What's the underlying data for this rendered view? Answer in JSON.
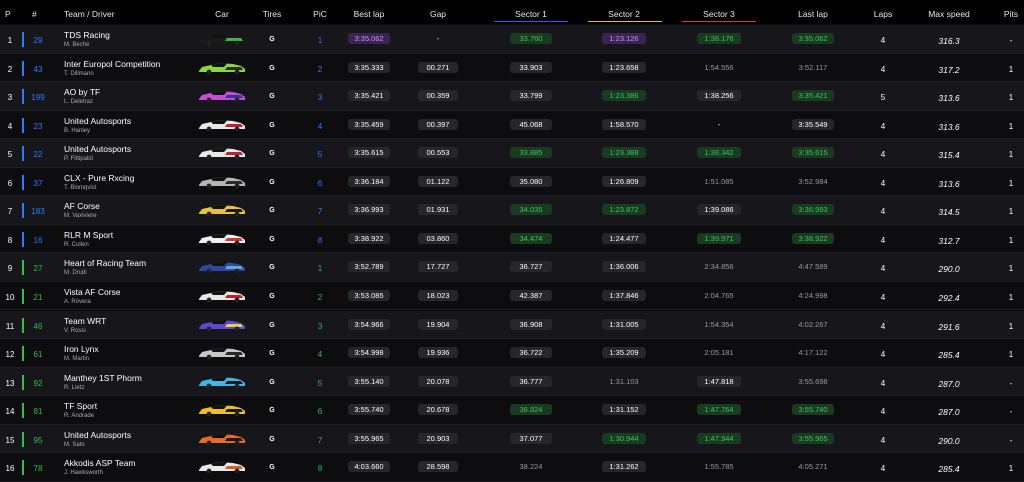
{
  "columns": {
    "p": "P",
    "num": "#",
    "team_driver": "Team / Driver",
    "car": "Car",
    "tires": "Tires",
    "pic": "PiC",
    "best_lap": "Best lap",
    "gap": "Gap",
    "sector1": "Sector 1",
    "sector2": "Sector 2",
    "sector3": "Sector 3",
    "last_lap": "Last lap",
    "laps": "Laps",
    "max_speed": "Max speed",
    "pits": "Pits"
  },
  "colors": {
    "hypercar": "#2f7bff",
    "lmgt3": "#2fbf4a",
    "sector1": "#3d4fff",
    "sector2": "#e6b84a",
    "sector3": "#d83a5a",
    "personal_best": "#35c759",
    "overall_best": "#b05cff"
  },
  "rows": [
    {
      "pos": "1",
      "num": "29",
      "team": "TDS Racing",
      "driver": "M. Beche",
      "class": "hypercar",
      "car_colors": [
        "#1a1a1a",
        "#45b34b"
      ],
      "tire": "G",
      "pic": "1",
      "best": "3:35.062",
      "best_s": "p",
      "gap": "-",
      "s1": "33.760",
      "s1_s": "g",
      "s2": "1:23.126",
      "s2_s": "p",
      "s3": "1:38.176",
      "s3_s": "g",
      "last": "3:35.062",
      "last_s": "g",
      "laps": "4",
      "speed": "316.3",
      "pits": "-"
    },
    {
      "pos": "2",
      "num": "43",
      "team": "Inter Europol Competition",
      "driver": "T. Dillmann",
      "class": "hypercar",
      "car_colors": [
        "#8fd63c",
        "#2a2a2a"
      ],
      "tire": "G",
      "pic": "2",
      "best": "3:35.333",
      "best_s": "w",
      "gap": "00.271",
      "s1": "33.903",
      "s1_s": "w",
      "s2": "1:23.658",
      "s2_s": "w",
      "s3": "1:54.556",
      "s3_s": "n",
      "last": "3:52.117",
      "last_s": "n",
      "laps": "4",
      "speed": "317.2",
      "pits": "1"
    },
    {
      "pos": "3",
      "num": "199",
      "team": "AO by TF",
      "driver": "L. Deletraz",
      "class": "hypercar",
      "car_colors": [
        "#c84bd6",
        "#2a3a8c"
      ],
      "tire": "G",
      "pic": "3",
      "best": "3:35.421",
      "best_s": "w",
      "gap": "00.359",
      "s1": "33.799",
      "s1_s": "w",
      "s2": "1:23.386",
      "s2_s": "g",
      "s3": "1:38.256",
      "s3_s": "w",
      "last": "3:35.421",
      "last_s": "g",
      "laps": "5",
      "speed": "313.6",
      "pits": "1"
    },
    {
      "pos": "4",
      "num": "23",
      "team": "United Autosports",
      "driver": "B. Hanley",
      "class": "hypercar",
      "car_colors": [
        "#e8e8e8",
        "#c0202a"
      ],
      "tire": "G",
      "pic": "4",
      "best": "3:35.459",
      "best_s": "w",
      "gap": "00.397",
      "s1": "45.068",
      "s1_s": "w",
      "s2": "1:58.570",
      "s2_s": "w",
      "s3": "-",
      "s3_s": "d",
      "last": "3:35.549",
      "last_s": "w",
      "laps": "4",
      "speed": "313.6",
      "pits": "1"
    },
    {
      "pos": "5",
      "num": "22",
      "team": "United Autosports",
      "driver": "P. Fittipaldi",
      "class": "hypercar",
      "car_colors": [
        "#e8e8e8",
        "#c0202a"
      ],
      "tire": "G",
      "pic": "5",
      "best": "3:35.615",
      "best_s": "w",
      "gap": "00.553",
      "s1": "33.885",
      "s1_s": "g",
      "s2": "1:23.388",
      "s2_s": "g",
      "s3": "1:38.342",
      "s3_s": "g",
      "last": "3:35.615",
      "last_s": "g",
      "laps": "4",
      "speed": "315.4",
      "pits": "1"
    },
    {
      "pos": "6",
      "num": "37",
      "team": "CLX - Pure Rxcing",
      "driver": "T. Blomqvist",
      "class": "hypercar",
      "car_colors": [
        "#b5b5b5",
        "#2a2a2a"
      ],
      "tire": "G",
      "pic": "6",
      "best": "3:36.184",
      "best_s": "w",
      "gap": "01.122",
      "s1": "35.080",
      "s1_s": "w",
      "s2": "1:26.809",
      "s2_s": "w",
      "s3": "1:51.085",
      "s3_s": "n",
      "last": "3:52.984",
      "last_s": "n",
      "laps": "4",
      "speed": "313.6",
      "pits": "1"
    },
    {
      "pos": "7",
      "num": "183",
      "team": "AF Corse",
      "driver": "M. Vaxiviere",
      "class": "hypercar",
      "car_colors": [
        "#e8c23a",
        "#1a1a1a"
      ],
      "tire": "G",
      "pic": "7",
      "best": "3:36.993",
      "best_s": "w",
      "gap": "01.931",
      "s1": "34.035",
      "s1_s": "g",
      "s2": "1:23.872",
      "s2_s": "g",
      "s3": "1:39.086",
      "s3_s": "w",
      "last": "3:36.993",
      "last_s": "g",
      "laps": "4",
      "speed": "314.5",
      "pits": "1"
    },
    {
      "pos": "8",
      "num": "16",
      "team": "RLR M Sport",
      "driver": "R. Cullen",
      "class": "hypercar",
      "car_colors": [
        "#f0f0f0",
        "#d03a2a"
      ],
      "tire": "G",
      "pic": "8",
      "best": "3:38.922",
      "best_s": "w",
      "gap": "03.860",
      "s1": "34.474",
      "s1_s": "g",
      "s2": "1:24.477",
      "s2_s": "w",
      "s3": "1:39.971",
      "s3_s": "g",
      "last": "3:38.922",
      "last_s": "g",
      "laps": "4",
      "speed": "312.7",
      "pits": "1"
    },
    {
      "pos": "9",
      "num": "27",
      "team": "Heart of Racing Team",
      "driver": "M. Drudi",
      "class": "lmgt3",
      "car_colors": [
        "#2a4aa0",
        "#6aa8d8"
      ],
      "tire": "G",
      "pic": "1",
      "best": "3:52.789",
      "best_s": "w",
      "gap": "17.727",
      "s1": "36.727",
      "s1_s": "w",
      "s2": "1:36.006",
      "s2_s": "w",
      "s3": "2:34.856",
      "s3_s": "n",
      "last": "4:47.589",
      "last_s": "n",
      "laps": "4",
      "speed": "290.0",
      "pits": "1"
    },
    {
      "pos": "10",
      "num": "21",
      "team": "Vista AF Corse",
      "driver": "A. Rovera",
      "class": "lmgt3",
      "car_colors": [
        "#e8e8e8",
        "#c02020"
      ],
      "tire": "G",
      "pic": "2",
      "best": "3:53.085",
      "best_s": "w",
      "gap": "18.023",
      "s1": "42.387",
      "s1_s": "w",
      "s2": "1:37.846",
      "s2_s": "w",
      "s3": "2:04.765",
      "s3_s": "n",
      "last": "4:24.998",
      "last_s": "n",
      "laps": "4",
      "speed": "292.4",
      "pits": "1"
    },
    {
      "pos": "11",
      "num": "46",
      "team": "Team WRT",
      "driver": "V. Rossi",
      "class": "lmgt3",
      "car_colors": [
        "#5a4ad0",
        "#e8d23a"
      ],
      "tire": "G",
      "pic": "3",
      "best": "3:54.966",
      "best_s": "w",
      "gap": "19.904",
      "s1": "36.908",
      "s1_s": "w",
      "s2": "1:31.005",
      "s2_s": "w",
      "s3": "1:54.354",
      "s3_s": "n",
      "last": "4:02.267",
      "last_s": "n",
      "laps": "4",
      "speed": "291.6",
      "pits": "1"
    },
    {
      "pos": "12",
      "num": "61",
      "team": "Iron Lynx",
      "driver": "M. Martin",
      "class": "lmgt3",
      "car_colors": [
        "#c8c8c8",
        "#2a2a2a"
      ],
      "tire": "G",
      "pic": "4",
      "best": "3:54.998",
      "best_s": "w",
      "gap": "19.936",
      "s1": "36.722",
      "s1_s": "w",
      "s2": "1:35.209",
      "s2_s": "w",
      "s3": "2:05.181",
      "s3_s": "n",
      "last": "4:17.122",
      "last_s": "n",
      "laps": "4",
      "speed": "285.4",
      "pits": "1"
    },
    {
      "pos": "13",
      "num": "92",
      "team": "Manthey 1ST Phorm",
      "driver": "R. Lietz",
      "class": "lmgt3",
      "car_colors": [
        "#3ab8e8",
        "#1a1a1a"
      ],
      "tire": "G",
      "pic": "5",
      "best": "3:55.140",
      "best_s": "w",
      "gap": "20.078",
      "s1": "36.777",
      "s1_s": "w",
      "s2": "1:31.103",
      "s2_s": "n",
      "s3": "1:47.818",
      "s3_s": "w",
      "last": "3:55.698",
      "last_s": "n",
      "laps": "4",
      "speed": "287.0",
      "pits": "-"
    },
    {
      "pos": "14",
      "num": "81",
      "team": "TF Sport",
      "driver": "R. Andrade",
      "class": "lmgt3",
      "car_colors": [
        "#f0c020",
        "#1a1a1a"
      ],
      "tire": "G",
      "pic": "6",
      "best": "3:55.740",
      "best_s": "w",
      "gap": "20.678",
      "s1": "36.824",
      "s1_s": "g",
      "s2": "1:31.152",
      "s2_s": "w",
      "s3": "1:47.764",
      "s3_s": "g",
      "last": "3:55.740",
      "last_s": "g",
      "laps": "4",
      "speed": "287.0",
      "pits": "-"
    },
    {
      "pos": "15",
      "num": "95",
      "team": "United Autosports",
      "driver": "M. Sato",
      "class": "lmgt3",
      "car_colors": [
        "#e86a2a",
        "#1a1a1a"
      ],
      "tire": "G",
      "pic": "7",
      "best": "3:55.965",
      "best_s": "w",
      "gap": "20.903",
      "s1": "37.077",
      "s1_s": "w",
      "s2": "1:30.944",
      "s2_s": "g",
      "s3": "1:47.944",
      "s3_s": "g",
      "last": "3:55.965",
      "last_s": "g",
      "laps": "4",
      "speed": "290.0",
      "pits": "-"
    },
    {
      "pos": "16",
      "num": "78",
      "team": "Akkodis ASP Team",
      "driver": "J. Hawksworth",
      "class": "lmgt3",
      "car_colors": [
        "#e8e8e8",
        "#d0602a"
      ],
      "tire": "G",
      "pic": "8",
      "best": "4:03.660",
      "best_s": "w",
      "gap": "28.598",
      "s1": "38.224",
      "s1_s": "n",
      "s2": "1:31.262",
      "s2_s": "w",
      "s3": "1:55.785",
      "s3_s": "n",
      "last": "4:05.271",
      "last_s": "n",
      "laps": "4",
      "speed": "285.4",
      "pits": "1"
    }
  ]
}
